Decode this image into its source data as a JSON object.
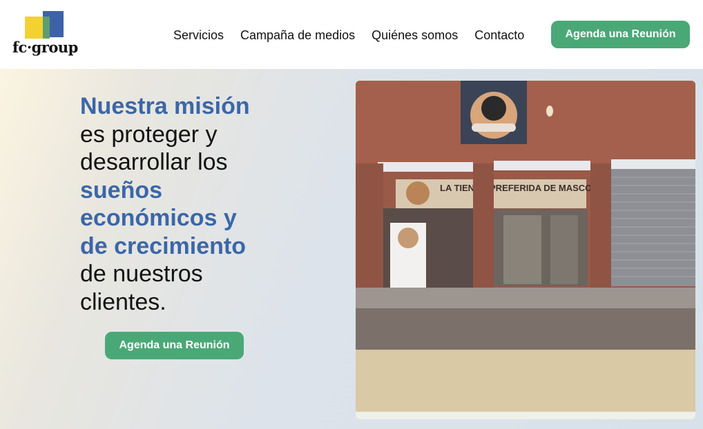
{
  "brand": {
    "logo_text": "fc·group"
  },
  "nav": {
    "items": [
      {
        "label": "Servicios"
      },
      {
        "label": "Campaña de medios"
      },
      {
        "label": "Quiénes somos"
      },
      {
        "label": "Contacto"
      }
    ],
    "cta_label": "Agenda una Reunión"
  },
  "hero": {
    "line1_accent": "Nuestra misión",
    "line2": "es proteger y",
    "line3": "desarrollar los",
    "line4_accent": "sueños",
    "line5_accent": "económicos y",
    "line6_accent": "de crecimiento",
    "line7": "de nuestros",
    "line8": "clientes.",
    "cta_label": "Agenda una Reunión"
  },
  "photo": {
    "sign_text": "LA TIENDA PREFERIDA DE MASCOTA"
  },
  "colors": {
    "accent_blue": "#3b67a8",
    "button_green": "#4aa877",
    "logo_yellow": "#f2d233",
    "logo_blue": "#3e62a8"
  }
}
